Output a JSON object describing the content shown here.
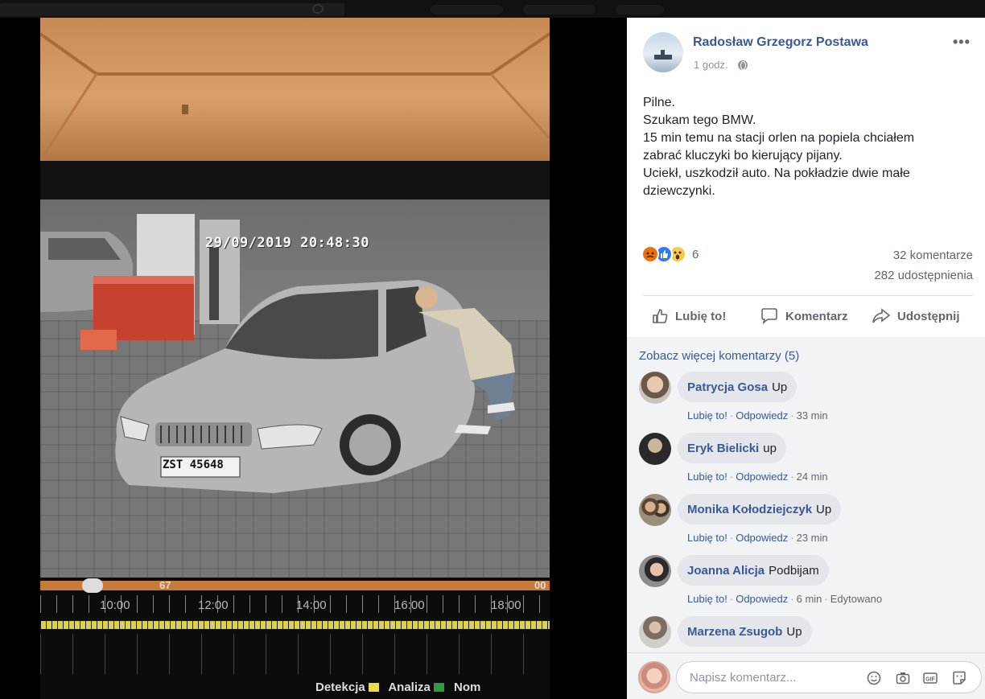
{
  "cctv": {
    "timestamp": "29/09/2019 20:48:30",
    "slider_value": "67",
    "slider_value_right": "00",
    "hours": [
      "10:00",
      "12:00",
      "14:00",
      "16:00",
      "18:00"
    ],
    "legend": [
      {
        "label": "Detekcja",
        "color": "#e6df4a"
      },
      {
        "label": "Analiza",
        "color": "#2f9b3f"
      },
      {
        "label": "Nom",
        "color": ""
      }
    ],
    "plate": "ZST 45648"
  },
  "post": {
    "author": "Radosław Grzegorz Postawa",
    "time": "1 godz.",
    "privacy_icon": "globe-icon",
    "more_icon": "more-options-icon",
    "text_lines": [
      "Pilne.",
      "Szukam tego BMW.",
      "15 min temu na stacji orlen na popiela chciałem",
      "zabrać kluczyki bo kierujący pijany.",
      "Uciekł, uszkodził auto. Na pokładzie dwie małe",
      "dziewczynki."
    ],
    "reaction_icons": [
      "angry-icon",
      "like-icon",
      "wow-icon"
    ],
    "reaction_count": "6",
    "comments_count": "32 komentarze",
    "shares_count": "282 udostępnienia",
    "actions": {
      "like": "Lubię to!",
      "comment": "Komentarz",
      "share": "Udostępnij"
    }
  },
  "comments": {
    "see_more": "Zobacz więcej komentarzy (5)",
    "items": [
      {
        "name": "Patrycja Gosa",
        "text": "Up",
        "like": "Lubię to!",
        "reply": "Odpowiedz",
        "time": "33 min",
        "edited": ""
      },
      {
        "name": "Eryk Bielicki",
        "text": "up",
        "like": "Lubię to!",
        "reply": "Odpowiedz",
        "time": "24 min",
        "edited": ""
      },
      {
        "name": "Monika Kołodziejczyk",
        "text": "Up",
        "like": "Lubię to!",
        "reply": "Odpowiedz",
        "time": "23 min",
        "edited": ""
      },
      {
        "name": "Joanna Alicja",
        "text": "Podbijam",
        "like": "Lubię to!",
        "reply": "Odpowiedz",
        "time": "6 min",
        "edited": "Edytowano"
      },
      {
        "name": "Marzena Zsugob",
        "text": "Up",
        "like": "",
        "reply": "",
        "time": "",
        "edited": ""
      }
    ],
    "compose_placeholder": "Napisz komentarz...",
    "compose_icons": [
      "emoji-icon",
      "camera-icon",
      "gif-icon",
      "sticker-icon"
    ]
  },
  "colors": {
    "link": "#385898",
    "text": "#1d2129",
    "muted": "#606770",
    "bubble": "#e4e6eb"
  }
}
